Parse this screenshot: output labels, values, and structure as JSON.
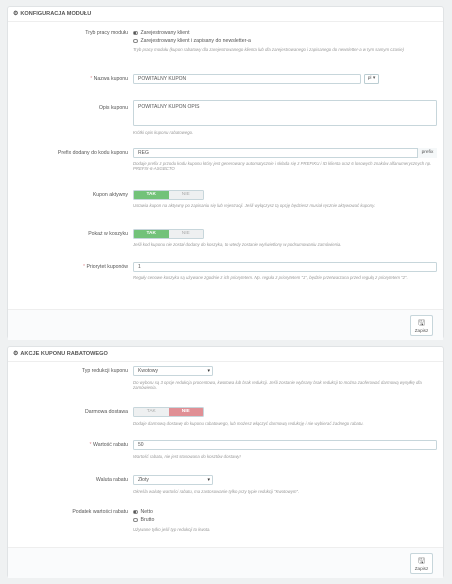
{
  "section1": {
    "title": "KONFIGURACJA MODUŁU",
    "mode": {
      "label": "Tryb pracy modułu",
      "options": [
        "Zarejestrowany klient",
        "Zarejestrowany klient i zapisany do newsletter-a"
      ],
      "selected": 0,
      "help": "Tryb pracy modułu (kupon rabatowy dla zarejestrowanego klienta lub dla zarejestrowanego i zapisanego do newsletter-a w tym samym czasie)"
    },
    "coupon_name": {
      "label": "Nazwa kuponu",
      "value": "POWITALNY KUPON",
      "lang": "pl",
      "required": true
    },
    "coupon_desc": {
      "label": "Opis kuponu",
      "value": "POWITALNY KUPON OPIS",
      "help": "Krótki opis kuponu rabatowego."
    },
    "prefix": {
      "label": "Prefix dodany do kodu kuponu",
      "value": "REG",
      "addon": "prefix",
      "help": "Dodaje prefix z przodu kodu kuponu który jest generowany automatycznie i składa się z PREFIKU i ID klienta oraz 6 losowych znaków alfanumerycznych np. PREFIX-6-ASGBCTO"
    },
    "active": {
      "label": "Kupon aktywny",
      "yes": "TAK",
      "no": "NIE",
      "value": "yes",
      "help": "Ustawia kupon na aktywny po zapisaniu się lub rejestracji. Jeśli wyłączysz tą opcję będziesz musiał ręcznie aktywować kupony."
    },
    "show_cart": {
      "label": "Pokaż w koszyku",
      "yes": "TAK",
      "no": "NIE",
      "value": "yes",
      "help": "Jeśli kod kuponu nie został dodany do koszyka, to wtedy zostanie wyświetlony w podsumowaniu zamówienia."
    },
    "priority": {
      "label": "Priorytet kuponów",
      "value": "1",
      "required": true,
      "help": "Reguły cenowe koszyka są używane zgodnie z ich priorytetem. Np. reguła z priorytetem \"1\", będzie przetwarzana przed regułą z priorytetem \"2\"."
    },
    "save": "Zapisz"
  },
  "section2": {
    "title": "AKCJE KUPONU RABATOWEGO",
    "reduction_type": {
      "label": "Typ redukcji kuponu",
      "value": "Kwotowy",
      "help": "Do wyboru są 3 opcje redukcja procentowa, kwotowa lub brak redukcji. Jeśli zostanie wybrany brak redukcji to można zaoferować darmową wysyłkę dla zamówienia."
    },
    "free_shipping": {
      "label": "Darmowa dostawa",
      "yes": "TAK",
      "no": "NIE",
      "value": "no",
      "help": "Dodaje darmową dostawę do kuponu rabatowego, lub możesz włączyć darmową redukcję i nie wybierać żadnego rabatu."
    },
    "discount_value": {
      "label": "Wartość rabatu",
      "value": "50",
      "required": true,
      "help": "Wartość rabatu, nie jest stosowana do kosztów dostawy!"
    },
    "currency": {
      "label": "Waluta rabatu",
      "value": "Złoty",
      "help": "Określa walutę wartości rabatu, ma zastosowanie tylko przy typie redukcji \"Kwotowym\"."
    },
    "tax": {
      "label": "Podatek wartości rabatu",
      "options": [
        "Netto",
        "Brutto"
      ],
      "selected": 0,
      "help": "Używane tylko jeśli typ redukcji to kwota."
    },
    "save": "Zapisz"
  }
}
